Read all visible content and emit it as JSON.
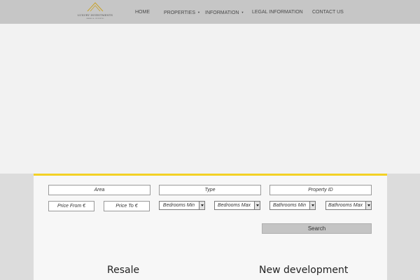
{
  "logo": {
    "name": "LUXURY INVESTMENTS",
    "tagline": "MARBELLA · PROPERTIES"
  },
  "nav": {
    "home": "HOME",
    "properties": "PROPERTIES",
    "information": "INFORMATION",
    "legal": "LEGAL INFORMATION",
    "contact": "CONTACT US"
  },
  "search": {
    "area_placeholder": "Area",
    "type_placeholder": "Type",
    "property_id_placeholder": "Property ID",
    "price_from_placeholder": "Price From €",
    "price_to_placeholder": "Price To €",
    "bedrooms_min": "Bedrooms Min",
    "bedrooms_max": "Bedrooms Max",
    "bathrooms_min": "Bathrooms Min",
    "bathrooms_max": "Bathrooms Max",
    "button_label": "Search"
  },
  "sections": {
    "resale": "Resale",
    "new_development": "New development"
  },
  "colors": {
    "accent": "#f3d125",
    "header_bg": "#c6c6c6"
  }
}
